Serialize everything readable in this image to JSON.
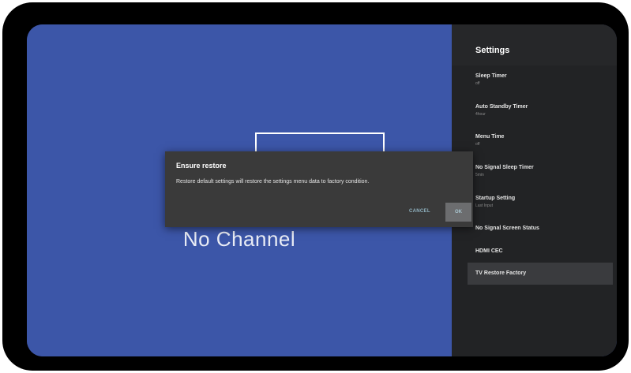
{
  "tv": {
    "status_text": "No Channel"
  },
  "settings": {
    "title": "Settings",
    "items": [
      {
        "label": "Sleep Timer",
        "value": "off"
      },
      {
        "label": "Auto Standby Timer",
        "value": "4hour"
      },
      {
        "label": "Menu Time",
        "value": "off"
      },
      {
        "label": "No Signal Sleep Timer",
        "value": "5min"
      },
      {
        "label": "Startup Setting",
        "value": "Last Input"
      },
      {
        "label": "No Signal Screen Status",
        "value": ""
      },
      {
        "label": "HDMI CEC",
        "value": ""
      },
      {
        "label": "TV Restore Factory",
        "value": "",
        "selected": true
      }
    ]
  },
  "dialog": {
    "title": "Ensure restore",
    "message": "Restore default settings will restore the settings menu data to factory condition.",
    "cancel_label": "CANCEL",
    "ok_label": "OK"
  },
  "colors": {
    "tv_background": "#3c56a8",
    "panel_background": "#222325",
    "dialog_background": "#3a3a3a",
    "ok_focus": "#6c6d6f"
  }
}
